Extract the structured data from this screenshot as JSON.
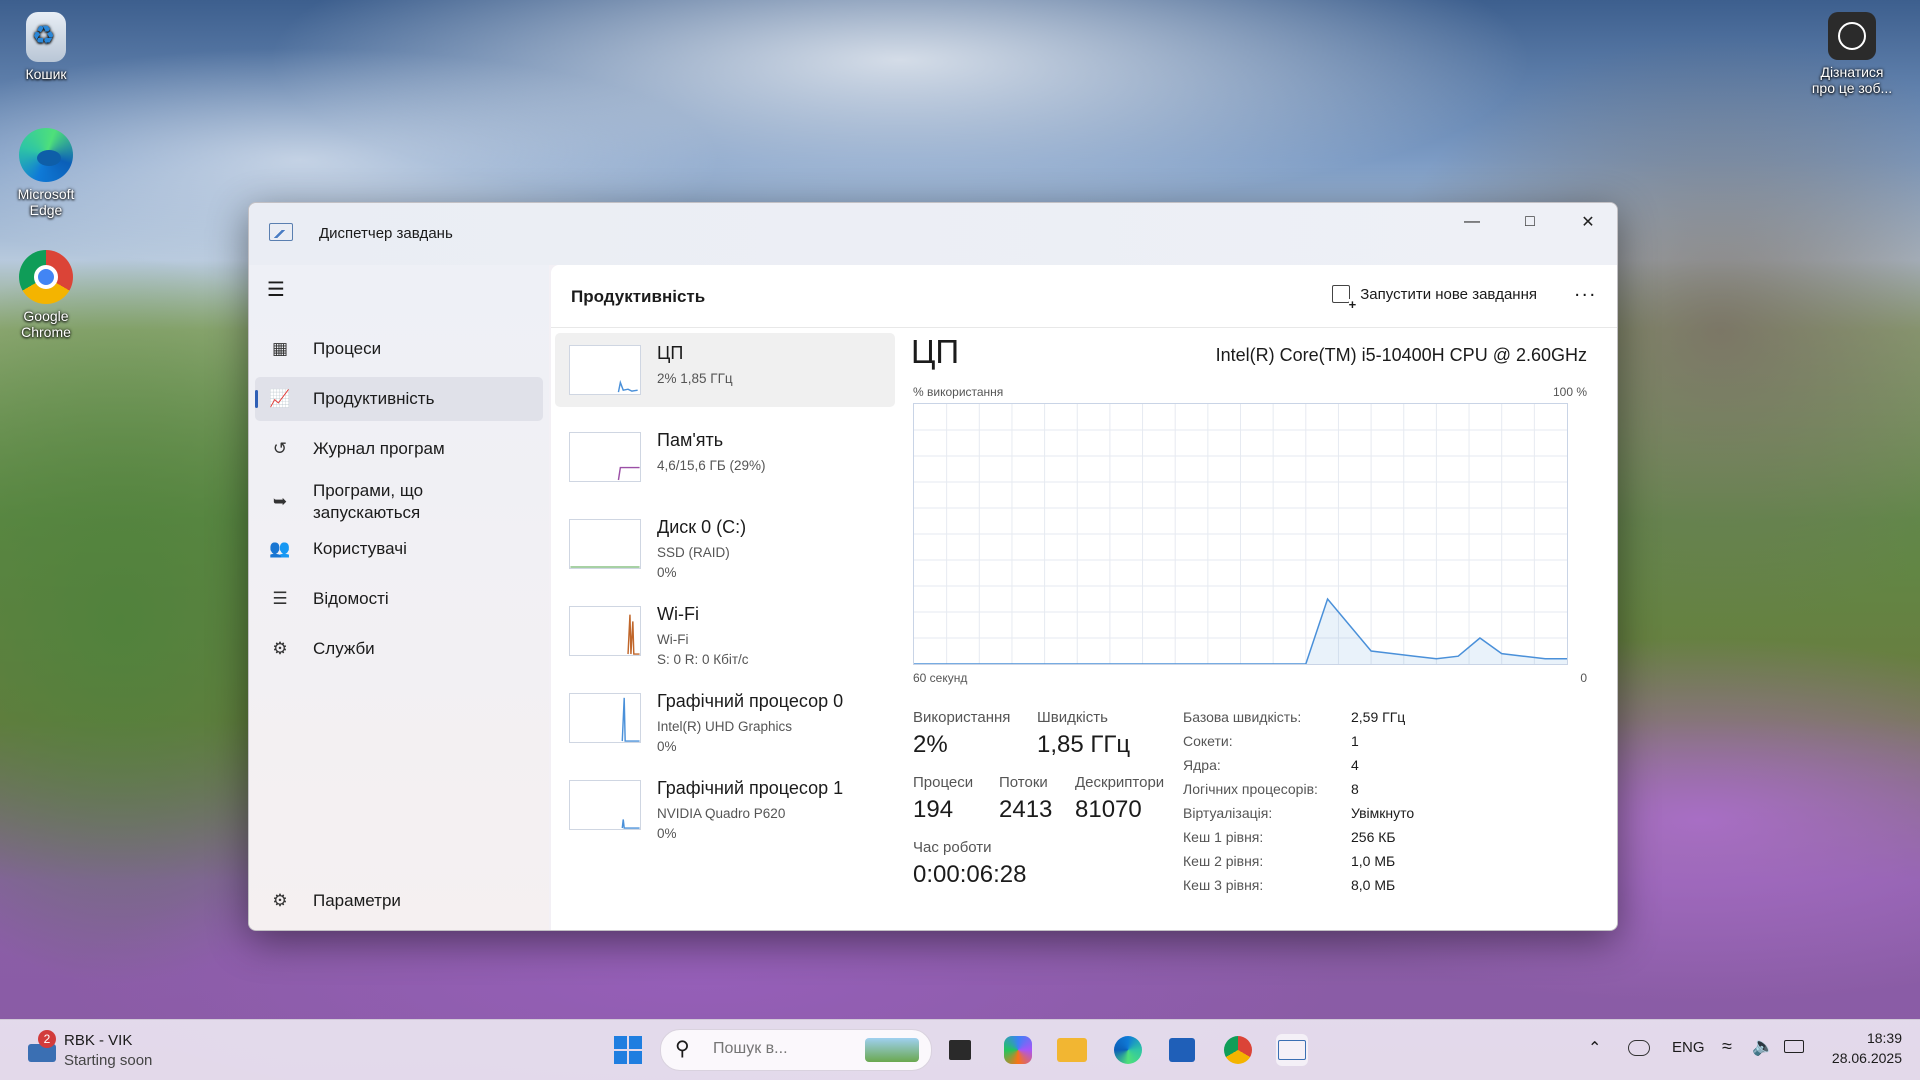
{
  "desktop": {
    "icons": [
      {
        "label": "Кошик"
      },
      {
        "label": "Microsoft Edge"
      },
      {
        "label": "Google Chrome"
      },
      {
        "label": "Дізнатися про це зоб..."
      }
    ]
  },
  "window": {
    "title": "Диспетчер завдань",
    "sidebar": {
      "items": [
        {
          "label": "Процеси",
          "icon": "processes-icon"
        },
        {
          "label": "Продуктивність",
          "icon": "performance-icon",
          "active": true
        },
        {
          "label": "Журнал програм",
          "icon": "history-icon"
        },
        {
          "label": "Програми, що запускаються",
          "icon": "startup-icon"
        },
        {
          "label": "Користувачі",
          "icon": "users-icon"
        },
        {
          "label": "Відомості",
          "icon": "details-icon"
        },
        {
          "label": "Служби",
          "icon": "services-icon"
        }
      ],
      "settings_label": "Параметри"
    },
    "header": {
      "title": "Продуктивність",
      "run_task_label": "Запустити нове завдання",
      "more_label": "..."
    },
    "devices": [
      {
        "name": "ЦП",
        "line1": "2% 1,85 ГГц",
        "line2": ""
      },
      {
        "name": "Пам'ять",
        "line1": "4,6/15,6 ГБ (29%)",
        "line2": ""
      },
      {
        "name": "Диск 0 (C:)",
        "line1": "SSD (RAID)",
        "line2": "0%"
      },
      {
        "name": "Wi-Fi",
        "line1": "Wi-Fi",
        "line2": "S: 0 R: 0 Кбіт/с"
      },
      {
        "name": "Графічний процесор 0",
        "line1": "Intel(R) UHD Graphics",
        "line2": "0%"
      },
      {
        "name": "Графічний процесор 1",
        "line1": "NVIDIA Quadro P620",
        "line2": "0%"
      }
    ],
    "details": {
      "title": "ЦП",
      "model": "Intel(R) Core(TM) i5-10400H CPU @ 2.60GHz",
      "y_label": "% використання",
      "y_max_label": "100 %",
      "x_label": "60 секунд",
      "x_min_label": "0",
      "usage_label": "Використання",
      "usage_value": "2%",
      "speed_label": "Швидкість",
      "speed_value": "1,85 ГГц",
      "processes_label": "Процеси",
      "processes_value": "194",
      "threads_label": "Потоки",
      "threads_value": "2413",
      "handles_label": "Дескриптори",
      "handles_value": "81070",
      "uptime_label": "Час роботи",
      "uptime_value": "0:00:06:28",
      "specs": [
        {
          "label": "Базова швидкість:",
          "value": "2,59 ГГц"
        },
        {
          "label": "Сокети:",
          "value": "1"
        },
        {
          "label": "Ядра:",
          "value": "4"
        },
        {
          "label": "Логічних процесорів:",
          "value": "8"
        },
        {
          "label": "Віртуалізація:",
          "value": "Увімкнуто"
        },
        {
          "label": "Кеш 1 рівня:",
          "value": "256 КБ"
        },
        {
          "label": "Кеш 2 рівня:",
          "value": "1,0 МБ"
        },
        {
          "label": "Кеш 3 рівня:",
          "value": "8,0 МБ"
        }
      ]
    },
    "colors": {
      "cpu_line": "#4a90d9",
      "memory_line": "#9b4fa6",
      "wifi_line": "#c0662a",
      "gpu_line": "#4a90d9"
    }
  },
  "chart_data": {
    "type": "area",
    "title": "",
    "xlabel": "60 секунд",
    "ylabel": "% використання",
    "ylim": [
      0,
      100
    ],
    "x": [
      60,
      55,
      50,
      45,
      40,
      35,
      30,
      24,
      22,
      20,
      18,
      16,
      14,
      12,
      10,
      8,
      6,
      4,
      2,
      0
    ],
    "series": [
      {
        "values": [
          0,
          0,
          0,
          0,
          0,
          0,
          0,
          0,
          25,
          15,
          5,
          4,
          3,
          2,
          3,
          10,
          4,
          3,
          2,
          2
        ]
      }
    ]
  },
  "taskbar": {
    "notification_title": "RBK - VIK",
    "notification_sub": "Starting soon",
    "notification_count": "2",
    "search_placeholder": "Пошук в...",
    "lang": "ENG",
    "time": "18:39",
    "date": "28.06.2025"
  }
}
